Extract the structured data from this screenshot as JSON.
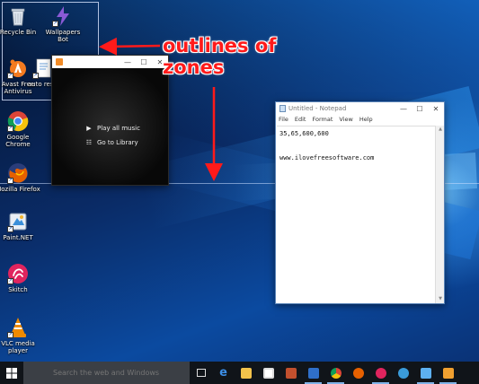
{
  "desktop_icons": [
    {
      "label": "Recycle Bin",
      "icon": "recycle-bin-icon"
    },
    {
      "label": "Wallpapers Bot",
      "icon": "wallpapers-bot-icon"
    },
    {
      "label": "Avast Free Antivirus",
      "icon": "avast-icon"
    },
    {
      "label": "auto resiz",
      "icon": "document-icon"
    },
    {
      "label": "Google Chrome",
      "icon": "chrome-icon"
    },
    {
      "label": "Mozilla Firefox",
      "icon": "firefox-icon"
    },
    {
      "label": "Paint.NET",
      "icon": "paint-net-icon"
    },
    {
      "label": "Skitch",
      "icon": "skitch-icon"
    },
    {
      "label": "VLC media player",
      "icon": "vlc-icon"
    }
  ],
  "music_window": {
    "items": [
      {
        "label": "Play all music",
        "icon": "play-icon"
      },
      {
        "label": "Go to Library",
        "icon": "library-icon"
      }
    ]
  },
  "notepad": {
    "title": "Untitled - Notepad",
    "menu": [
      "File",
      "Edit",
      "Format",
      "View",
      "Help"
    ],
    "content": "35,65,600,600\n\n\nwww.ilovefreesoftware.com"
  },
  "annotation": {
    "line1": "outlines of",
    "line2": "zones"
  },
  "taskbar": {
    "search_placeholder": "Search the web and Windows",
    "apps": [
      "task-view-icon",
      "edge-icon",
      "file-explorer-icon",
      "store-icon",
      "app-icon",
      "app-icon",
      "chrome-icon",
      "firefox-icon",
      "skitch-icon",
      "app-icon",
      "app-icon",
      "app-icon"
    ]
  },
  "colors": {
    "annotation": "#ff1a1a",
    "taskbar": "#101419"
  }
}
